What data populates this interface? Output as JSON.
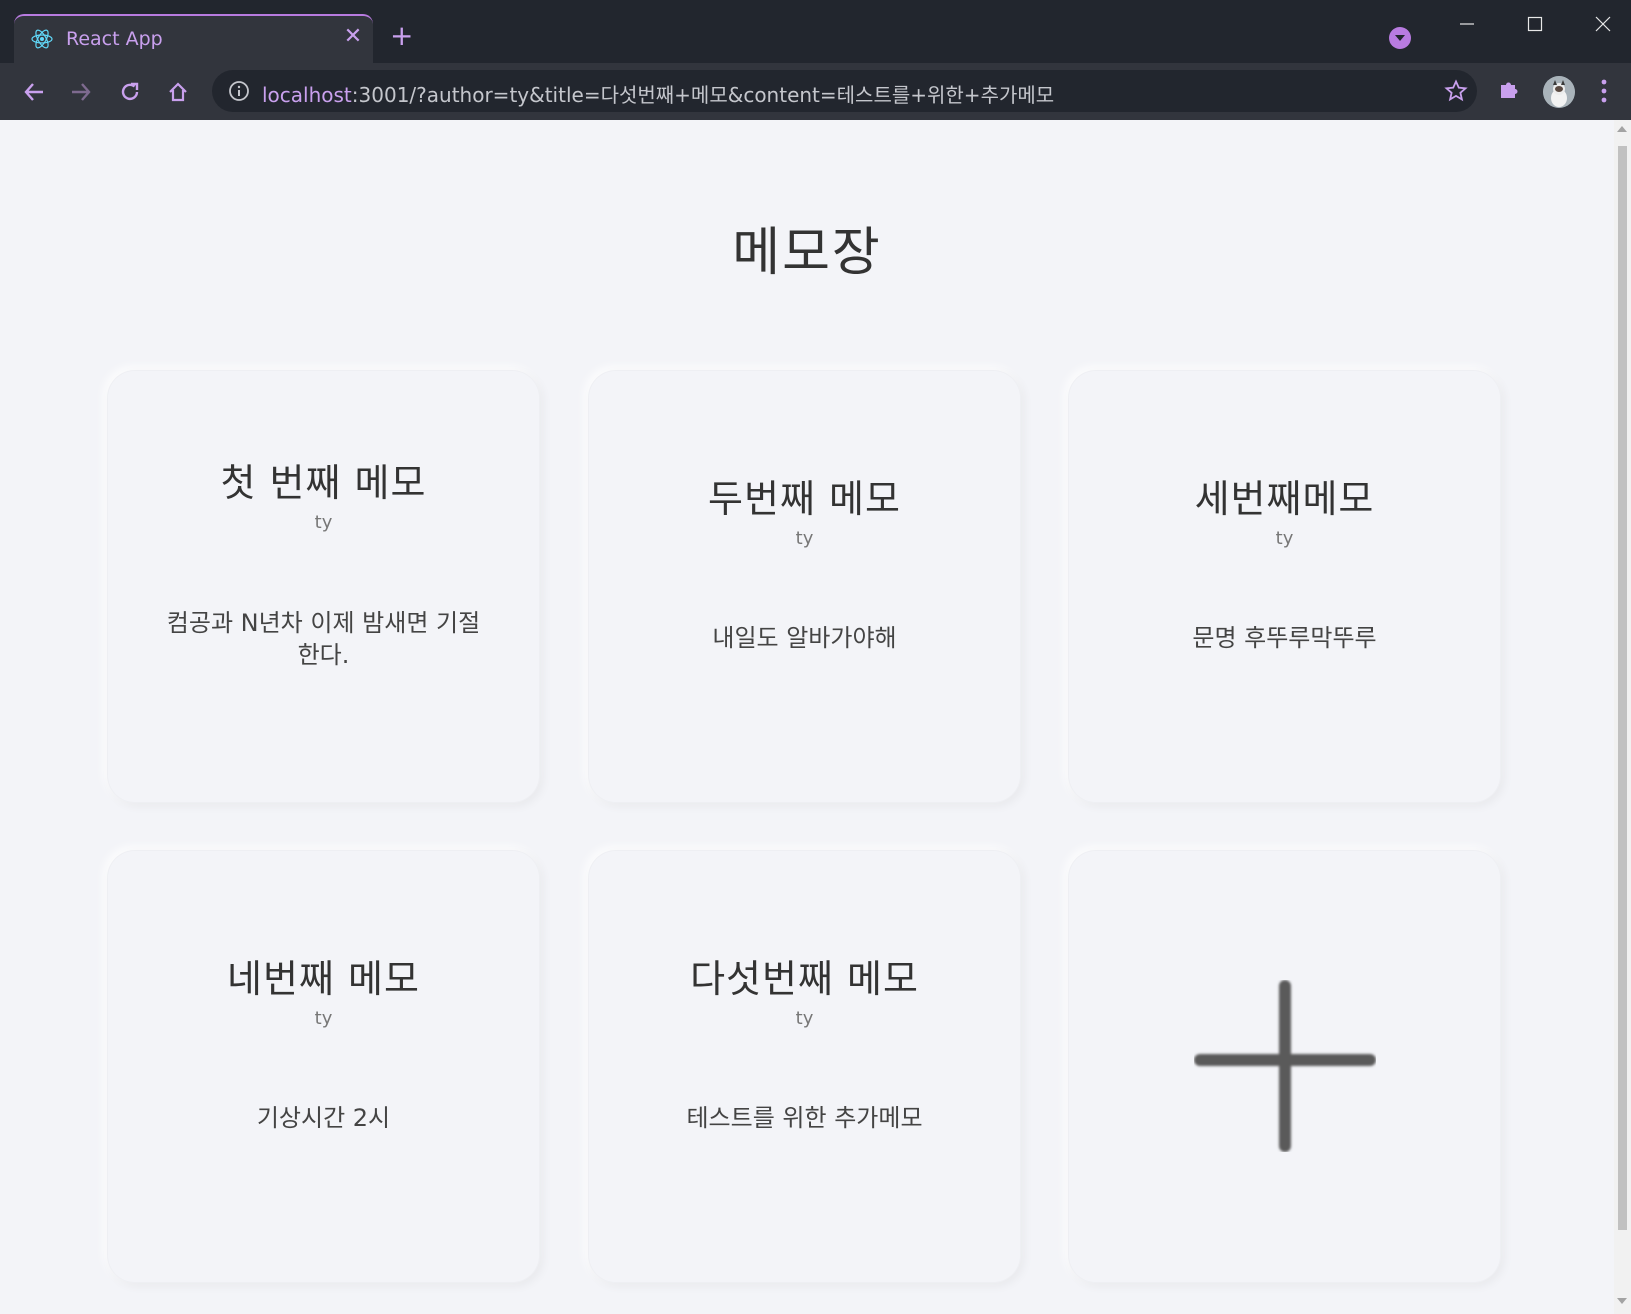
{
  "tab": {
    "title": "React App",
    "close": "✕",
    "new_tab": "+"
  },
  "toolbar": {
    "url_host": "localhost",
    "url_rest": ":3001/?author=ty&title=다섯번째+메모&content=테스트를+위한+추가메모"
  },
  "page": {
    "title": "메모장"
  },
  "memos": [
    {
      "title": "첫 번째 메모",
      "author": "ty",
      "content": "컴공과 N년차 이제 밤새면 기절한다."
    },
    {
      "title": "두번째 메모",
      "author": "ty",
      "content": "내일도 알바가야해"
    },
    {
      "title": "세번째메모",
      "author": "ty",
      "content": "문명 후뚜루막뚜루"
    },
    {
      "title": "네번째 메모",
      "author": "ty",
      "content": "기상시간 2시"
    },
    {
      "title": "다섯번째 메모",
      "author": "ty",
      "content": "테스트를 위한 추가메모"
    }
  ],
  "icons": {
    "favicon": "react-icon",
    "add": "plus-icon"
  },
  "colors": {
    "accent": "#c9a0ee",
    "page_bg": "#f3f4f8",
    "chrome_dark": "#22262e",
    "chrome_toolbar": "#32353d"
  }
}
